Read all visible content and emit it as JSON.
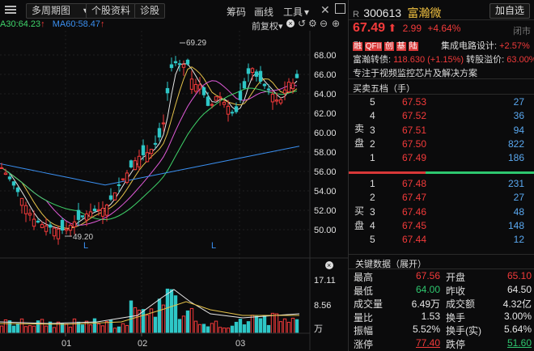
{
  "toolbar_left": {
    "dropdown_label": "多周期图",
    "tab_individual": "个股资料",
    "tab_diagnose": "诊股"
  },
  "toolbar_right": {
    "chips": "筹码",
    "draw": "画线",
    "tools": "工具",
    "tools_arrow": "▾"
  },
  "indicator_bar": {
    "ma30": "A30:64.23",
    "ma60": "MA60:58.47",
    "pre_adjust": "前复权",
    "pre_adjust_arrow": "▾"
  },
  "price_axis": [
    "68.00",
    "66.00",
    "64.00",
    "62.00",
    "60.00",
    "58.00",
    "56.00",
    "54.00",
    "52.00",
    "50.00"
  ],
  "volume_axis": [
    "17.11",
    "8.56",
    "万"
  ],
  "annotations": {
    "high_label": "69.29",
    "low_label": "49.20",
    "l_marker": "L"
  },
  "date_axis": [
    "01",
    "02",
    "03"
  ],
  "stock": {
    "prefix": "R",
    "code": "300613",
    "name": "富瀚微",
    "add_button": "加自选",
    "price": "67.49",
    "arrow": "⬆",
    "change": "2.99",
    "change_pct": "+4.64%",
    "status": "闭市",
    "sector_label": "集成电路设计:",
    "sector_pct": "+2.57%",
    "convertible_label": "富瀚转债:",
    "convertible_value": "118.630",
    "convertible_pct": "(+1.15%)",
    "premium_label": "转股溢价:",
    "premium_value": "63.00%",
    "description": "专注于视频监控芯片及解决方案",
    "badges": [
      "融",
      "QFII",
      "创",
      "基",
      "陆"
    ]
  },
  "orderbook": {
    "title": "买卖五档（手）",
    "sell_label": [
      "卖",
      "盘"
    ],
    "buy_label": [
      "买",
      "盘"
    ],
    "sells": [
      {
        "level": "5",
        "price": "67.53",
        "vol": "27"
      },
      {
        "level": "4",
        "price": "67.52",
        "vol": "36"
      },
      {
        "level": "3",
        "price": "67.51",
        "vol": "94"
      },
      {
        "level": "2",
        "price": "67.50",
        "vol": "822"
      },
      {
        "level": "1",
        "price": "67.49",
        "vol": "186"
      }
    ],
    "buys": [
      {
        "level": "1",
        "price": "67.48",
        "vol": "231"
      },
      {
        "level": "2",
        "price": "67.47",
        "vol": "27"
      },
      {
        "level": "3",
        "price": "67.46",
        "vol": "48"
      },
      {
        "level": "4",
        "price": "67.45",
        "vol": "148"
      },
      {
        "level": "5",
        "price": "67.44",
        "vol": "12"
      }
    ]
  },
  "key_data": {
    "title": "关键数据（展开）",
    "rows": [
      {
        "k1": "最高",
        "v1": "67.56",
        "k2": "开盘",
        "v2": "65.10"
      },
      {
        "k1": "最低",
        "v1": "64.00",
        "k2": "昨收",
        "v2": "64.50"
      },
      {
        "k1": "成交量",
        "v1": "6.49万",
        "k2": "成交额",
        "v2": "4.32亿"
      },
      {
        "k1": "量比",
        "v1": "1.53",
        "k2": "换手",
        "v2": "3.00%"
      },
      {
        "k1": "振幅",
        "v1": "5.52%",
        "k2": "换手(实)",
        "v2": "5.64%"
      },
      {
        "k1": "涨停",
        "v1": "77.40",
        "k2": "跌停",
        "v2": "51.60"
      }
    ]
  },
  "colors": {
    "up": "#f23a3a",
    "down": "#2ec7c7",
    "ma5": "#e6e6e6",
    "ma10": "#e6c34a",
    "ma20": "#e05ad8",
    "ma30": "#3fd46a",
    "ma60": "#3a8ff0"
  }
}
